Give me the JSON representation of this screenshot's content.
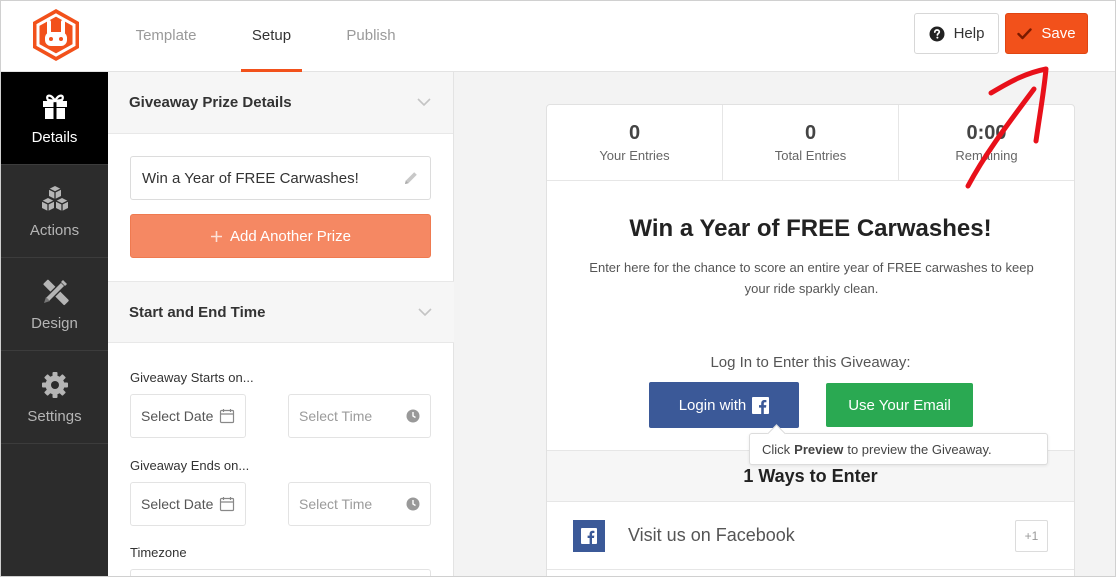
{
  "header": {
    "tabs": [
      {
        "label": "Template"
      },
      {
        "label": "Setup"
      },
      {
        "label": "Publish"
      }
    ],
    "help_label": "Help",
    "save_label": "Save"
  },
  "sidebar": {
    "items": [
      {
        "label": "Details",
        "icon": "gift-icon"
      },
      {
        "label": "Actions",
        "icon": "cubes-icon"
      },
      {
        "label": "Design",
        "icon": "design-tools-icon"
      },
      {
        "label": "Settings",
        "icon": "gear-icon"
      }
    ]
  },
  "panel": {
    "prize_section_title": "Giveaway Prize Details",
    "prize_value": "Win a Year of FREE Carwashes!",
    "add_prize_label": "Add Another Prize",
    "time_section_title": "Start and End Time",
    "starts_label": "Giveaway Starts on...",
    "ends_label": "Giveaway Ends on...",
    "date_placeholder": "Select Date",
    "time_placeholder": "Select Time",
    "timezone_label": "Timezone"
  },
  "preview": {
    "stats": [
      {
        "value": "0",
        "label": "Your Entries"
      },
      {
        "value": "0",
        "label": "Total Entries"
      },
      {
        "value": "0:00",
        "label": "Remaining"
      }
    ],
    "title": "Win a Year of FREE Carwashes!",
    "description": "Enter here for the chance to score an entire year of FREE carwashes to keep your ride sparkly clean.",
    "login_label": "Log In to Enter this Giveaway:",
    "fb_login_label": "Login with",
    "email_label": "Use Your Email",
    "ways_title": "1 Ways to Enter",
    "entry_label": "Visit us on Facebook",
    "entry_badge": "+1"
  },
  "tooltip": {
    "before": "Click",
    "emphasis": "Preview",
    "after": "to preview the Giveaway."
  },
  "colors": {
    "accent": "#f2511b",
    "add_prize": "#f58863",
    "facebook": "#3b5998",
    "email_green": "#2aa952",
    "sidebar_bg": "#2c2c2c",
    "annotation_arrow": "#e8101a"
  }
}
